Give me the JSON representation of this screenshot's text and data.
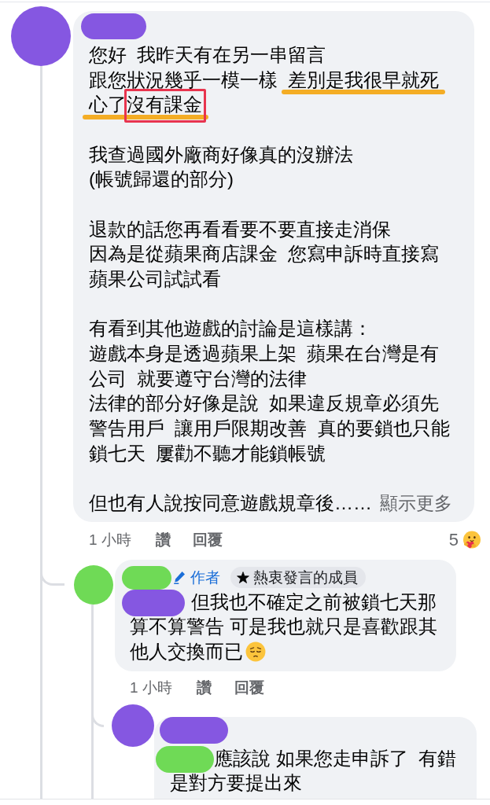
{
  "comments": [
    {
      "author": {
        "color": "#8557e1"
      },
      "paragraphs": [
        {
          "lines": [
            {
              "segments": [
                {
                  "text": "您好  我昨天有在另一串留言",
                  "underlined": false,
                  "boxed": false
                }
              ]
            },
            {
              "segments": [
                {
                  "text": "跟您狀況幾乎一模一樣  ",
                  "underlined": false,
                  "boxed": false
                },
                {
                  "text": "差別是我很早就死心了",
                  "underlined": true,
                  "boxed": false
                },
                {
                  "text": "沒有課金",
                  "underlined": true,
                  "boxed": true
                }
              ]
            }
          ]
        },
        {
          "lines": [
            {
              "segments": [
                {
                  "text": "我查過國外廠商好像真的沒辦法",
                  "underlined": false,
                  "boxed": false
                }
              ]
            },
            {
              "segments": [
                {
                  "text": "(帳號歸還的部分)",
                  "underlined": false,
                  "boxed": false
                }
              ]
            }
          ]
        },
        {
          "lines": [
            {
              "segments": [
                {
                  "text": "退款的話您再看看要不要直接走消保",
                  "underlined": false,
                  "boxed": false
                }
              ]
            },
            {
              "segments": [
                {
                  "text": "因為是從蘋果商店課金  您寫申訴時直接寫蘋果公司試試看",
                  "underlined": false,
                  "boxed": false
                }
              ]
            }
          ]
        },
        {
          "lines": [
            {
              "segments": [
                {
                  "text": "有看到其他遊戲的討論是這樣講：",
                  "underlined": false,
                  "boxed": false
                }
              ]
            },
            {
              "segments": [
                {
                  "text": "遊戲本身是透過蘋果上架  蘋果在台灣是有公司  就要遵守台灣的法律",
                  "underlined": false,
                  "boxed": false
                }
              ]
            },
            {
              "segments": [
                {
                  "text": "法律的部分好像是說  如果違反規章必須先警告用戶  讓用戶限期改善  真的要鎖也只能鎖七天  屢勸不聽才能鎖帳號",
                  "underlined": false,
                  "boxed": false
                }
              ]
            }
          ]
        },
        {
          "lines": [
            {
              "segments": [
                {
                  "text": "但也有人說按同意遊戲規章後……",
                  "underlined": false,
                  "boxed": false
                }
              ]
            }
          ]
        }
      ],
      "see_more": "顯示更多",
      "time": "1 小時",
      "like": "讚",
      "reply": "回覆",
      "reactions": {
        "kind": "care",
        "count": "5"
      },
      "replies": [
        {
          "author": {
            "color": "#6fda56"
          },
          "author_label": "作者",
          "badge": "熱衷發言的成員",
          "mention": {
            "color": "#8557e1"
          },
          "text": "但我也不確定之前被鎖七天那算不算警告 可是我也就只是喜歡跟其他人交換而已",
          "emoji": {
            "kind": "pensive"
          },
          "time": "1 小時",
          "like": "讚",
          "reply": "回覆",
          "replies": [
            {
              "author": {
                "color": "#8557e1"
              },
              "mention": {
                "color": "#6fda56"
              },
              "text": "應該說 如果您走申訴了  有錯是對方要提出來"
            }
          ]
        }
      ]
    }
  ]
}
